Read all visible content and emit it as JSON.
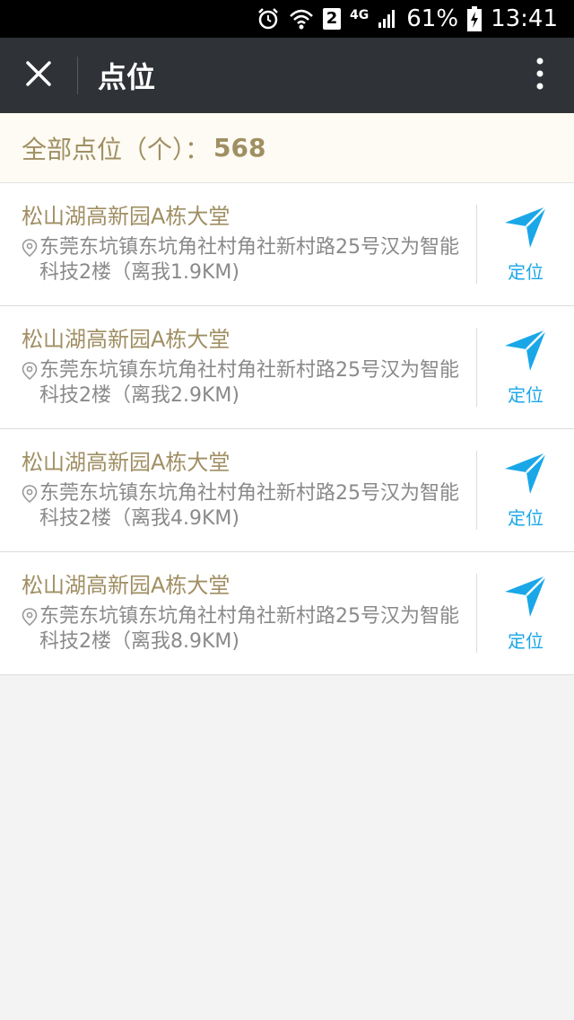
{
  "status_bar": {
    "sim_badge": "2",
    "network": "4G",
    "battery": "61%",
    "time": "13:41"
  },
  "nav": {
    "title": "点位"
  },
  "summary": {
    "label": "全部点位（个）：",
    "count": "568"
  },
  "items": [
    {
      "title": "松山湖高新园A栋大堂",
      "address": "东莞东坑镇东坑角社村角社新村路25号汉为智能科技2楼（离我1.9KM)",
      "locate_label": "定位"
    },
    {
      "title": "松山湖高新园A栋大堂",
      "address": "东莞东坑镇东坑角社村角社新村路25号汉为智能科技2楼（离我2.9KM)",
      "locate_label": "定位"
    },
    {
      "title": "松山湖高新园A栋大堂",
      "address": "东莞东坑镇东坑角社村角社新村路25号汉为智能科技2楼（离我4.9KM)",
      "locate_label": "定位"
    },
    {
      "title": "松山湖高新园A栋大堂",
      "address": "东莞东坑镇东坑角社村角社新村路25号汉为智能科技2楼（离我8.9KM)",
      "locate_label": "定位"
    }
  ],
  "icons": {
    "close": "close-icon",
    "more": "more-vertical-icon",
    "pin": "location-pin-icon",
    "navigate": "navigation-arrow-icon"
  },
  "colors": {
    "accent_gold": "#a08f63",
    "accent_blue": "#1aa7e8",
    "navbar": "#2f3236"
  }
}
